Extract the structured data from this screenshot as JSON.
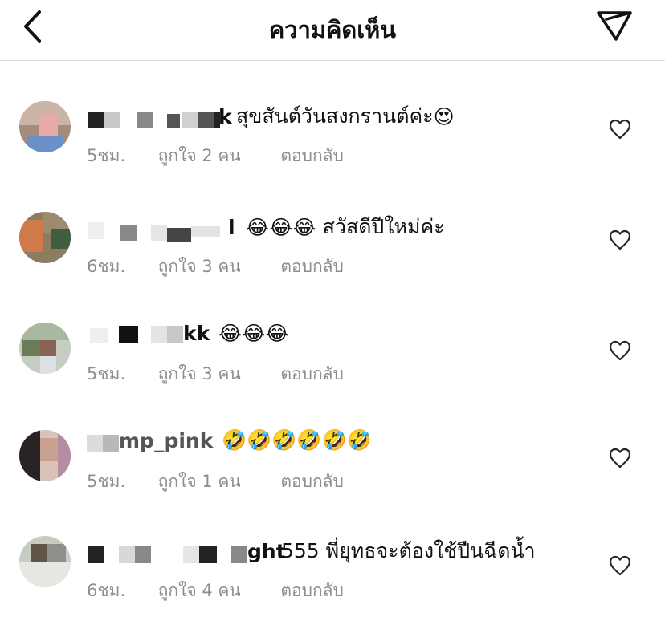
{
  "header": {
    "title": "ความคิดเห็น",
    "back_icon": "chevron-left-icon",
    "send_icon": "paper-plane-icon"
  },
  "comments": [
    {
      "username_visible": "k",
      "text": "สุขสันต์วันสงกรานต์ค่ะ",
      "emojis": "😍",
      "time": "5ชม.",
      "likes": "ถูกใจ 2 คน",
      "reply": "ตอบกลับ"
    },
    {
      "username_visible": "l",
      "text": "สวัสดีปีใหม่ค่ะ",
      "emojis": "😂😂😂",
      "time": "6ชม.",
      "likes": "ถูกใจ 3 คน",
      "reply": "ตอบกลับ"
    },
    {
      "username_visible": "kk",
      "text": "",
      "emojis": "😂😂😂",
      "time": "5ชม.",
      "likes": "ถูกใจ 3 คน",
      "reply": "ตอบกลับ"
    },
    {
      "username_visible": "mp_pink",
      "text": "",
      "emojis": "🤣🤣🤣🤣🤣🤣",
      "time": "5ชม.",
      "likes": "ถูกใจ 1 คน",
      "reply": "ตอบกลับ"
    },
    {
      "username_visible": "ght",
      "text": "555 พี่ยุทธจะต้องใช้ปืนฉีดน้ำ",
      "emojis": "",
      "time": "6ชม.",
      "likes": "ถูกใจ 4 คน",
      "reply": "ตอบกลับ"
    }
  ],
  "colors": {
    "text": "#111111",
    "meta": "#8e8e8e",
    "divider": "#dbdbdb",
    "icon": "#262626"
  }
}
